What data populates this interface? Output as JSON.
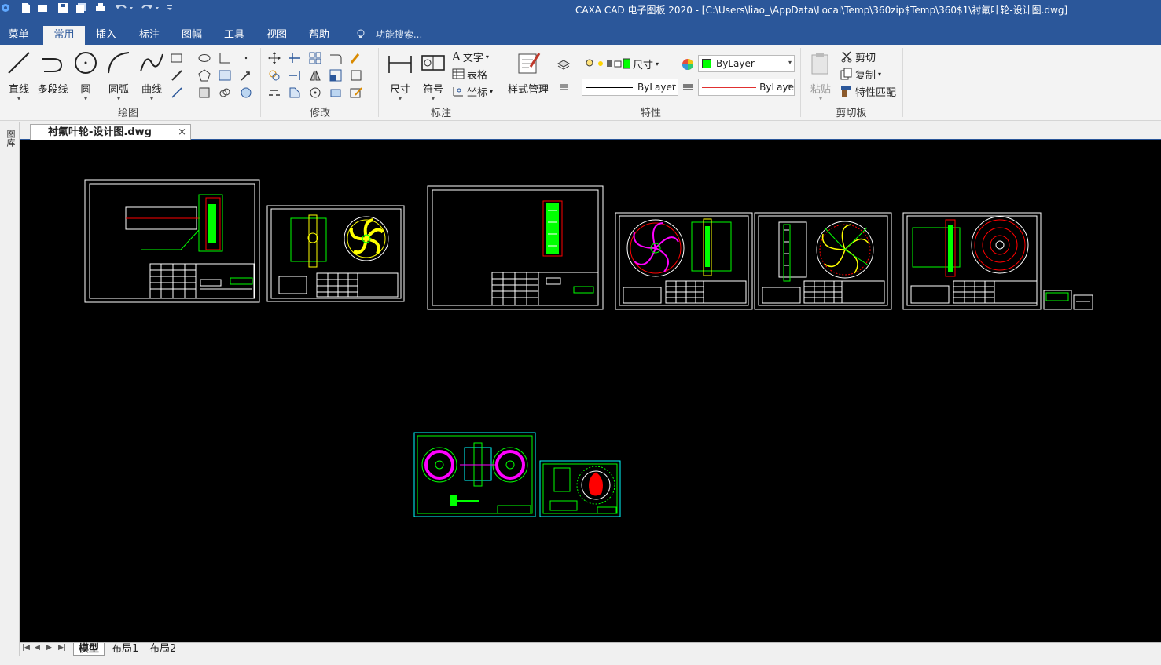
{
  "window": {
    "title": "CAXA CAD 电子图板 2020 - [C:\\Users\\liao_\\AppData\\Local\\Temp\\360zip$Temp\\360$1\\衬氟叶轮-设计图.dwg]"
  },
  "quick_access": [
    "app-logo-icon",
    "new-file-icon",
    "open-file-icon",
    "save-icon",
    "save-all-icon",
    "print-icon",
    "undo-icon",
    "redo-icon",
    "customize-icon"
  ],
  "menu": {
    "tabs": [
      {
        "label": "菜单",
        "active": false
      },
      {
        "label": "常用",
        "active": true
      },
      {
        "label": "插入",
        "active": false
      },
      {
        "label": "标注",
        "active": false
      },
      {
        "label": "图幅",
        "active": false
      },
      {
        "label": "工具",
        "active": false
      },
      {
        "label": "视图",
        "active": false
      },
      {
        "label": "帮助",
        "active": false
      }
    ],
    "search_placeholder": "功能搜索..."
  },
  "ribbon": {
    "draw": {
      "group_label": "绘图",
      "buttons": [
        "直线",
        "多段线",
        "圆",
        "圆弧",
        "曲线"
      ]
    },
    "modify": {
      "group_label": "修改"
    },
    "annotate": {
      "group_label": "标注",
      "buttons": [
        "尺寸",
        "符号"
      ],
      "small": [
        "文字",
        "表格",
        "坐标"
      ]
    },
    "properties": {
      "group_label": "特性",
      "style_manager": "样式管理",
      "dim_style": "尺寸",
      "color_value": "ByLayer",
      "linetype_value": "ByLayer",
      "lineweight_value": "ByLaye",
      "accent_color": "#00ff00"
    },
    "clipboard": {
      "group_label": "剪切板",
      "paste": "粘贴",
      "cut": "剪切",
      "copy": "复制",
      "match_props": "特性匹配"
    }
  },
  "side_panel": {
    "label": "图库"
  },
  "document": {
    "tab_label": "衬氟叶轮-设计图.dwg",
    "close_glyph": "×"
  },
  "layout_tabs": [
    {
      "label": "模型",
      "active": true
    },
    {
      "label": "布局1",
      "active": false
    },
    {
      "label": "布局2",
      "active": false
    }
  ],
  "colors": {
    "brand": "#2b579a",
    "canvas": "#000000",
    "frame": "#ffffff",
    "geom_green": "#00ff00",
    "geom_magenta": "#ff00ff",
    "geom_red": "#ff0000",
    "geom_yellow": "#ffff00",
    "geom_cyan": "#00ffff"
  }
}
